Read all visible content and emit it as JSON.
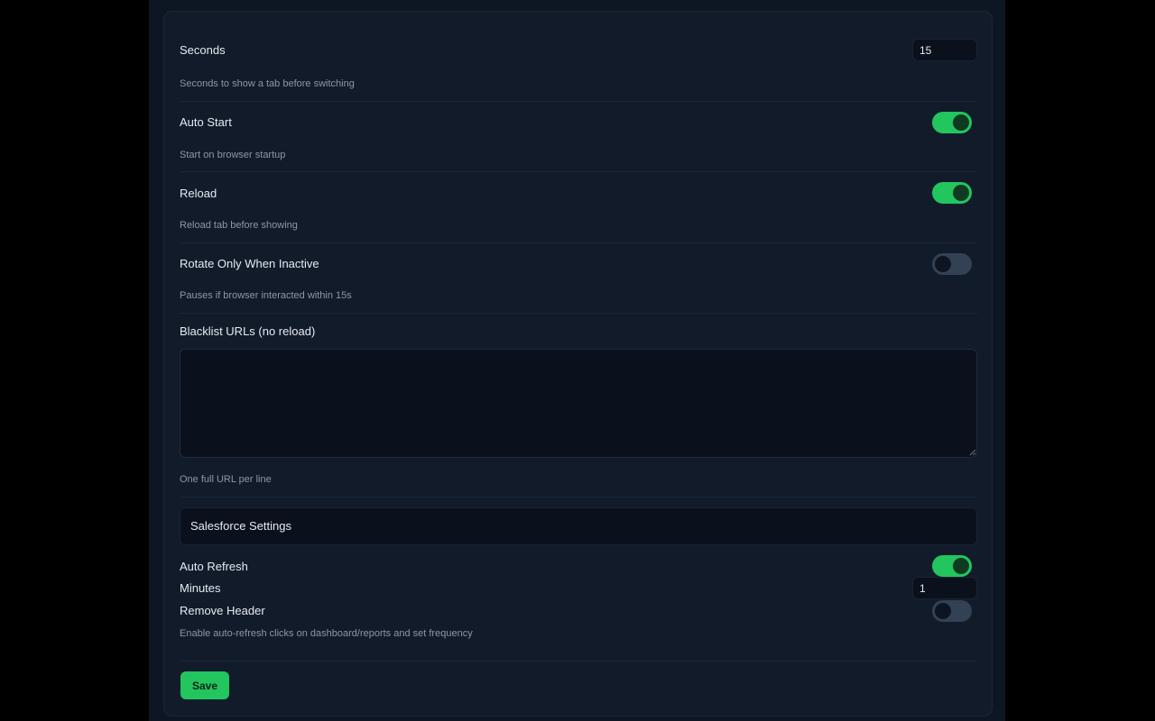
{
  "general": {
    "seconds_label": "Seconds",
    "seconds_value": "15",
    "seconds_hint": "Seconds to show a tab before switching",
    "auto_start_label": "Auto Start",
    "auto_start_on": true,
    "auto_start_hint": "Start on browser startup",
    "reload_label": "Reload",
    "reload_on": true,
    "reload_hint": "Reload tab before showing",
    "rotate_inactive_label": "Rotate Only When Inactive",
    "rotate_inactive_on": false,
    "rotate_inactive_hint": "Pauses if browser interacted within 15s",
    "blacklist_label": "Blacklist URLs (no reload)",
    "blacklist_value": "",
    "blacklist_hint": "One full URL per line"
  },
  "salesforce": {
    "section_title": "Salesforce Settings",
    "auto_refresh_label": "Auto Refresh",
    "auto_refresh_on": true,
    "minutes_label": "Minutes",
    "minutes_value": "1",
    "remove_header_label": "Remove Header",
    "remove_header_on": false,
    "hint": "Enable auto-refresh clicks on dashboard/reports and set frequency"
  },
  "actions": {
    "save_label": "Save"
  },
  "colors": {
    "accent": "#22c55e",
    "toggle_off": "#334155",
    "background": "#121b2a"
  }
}
